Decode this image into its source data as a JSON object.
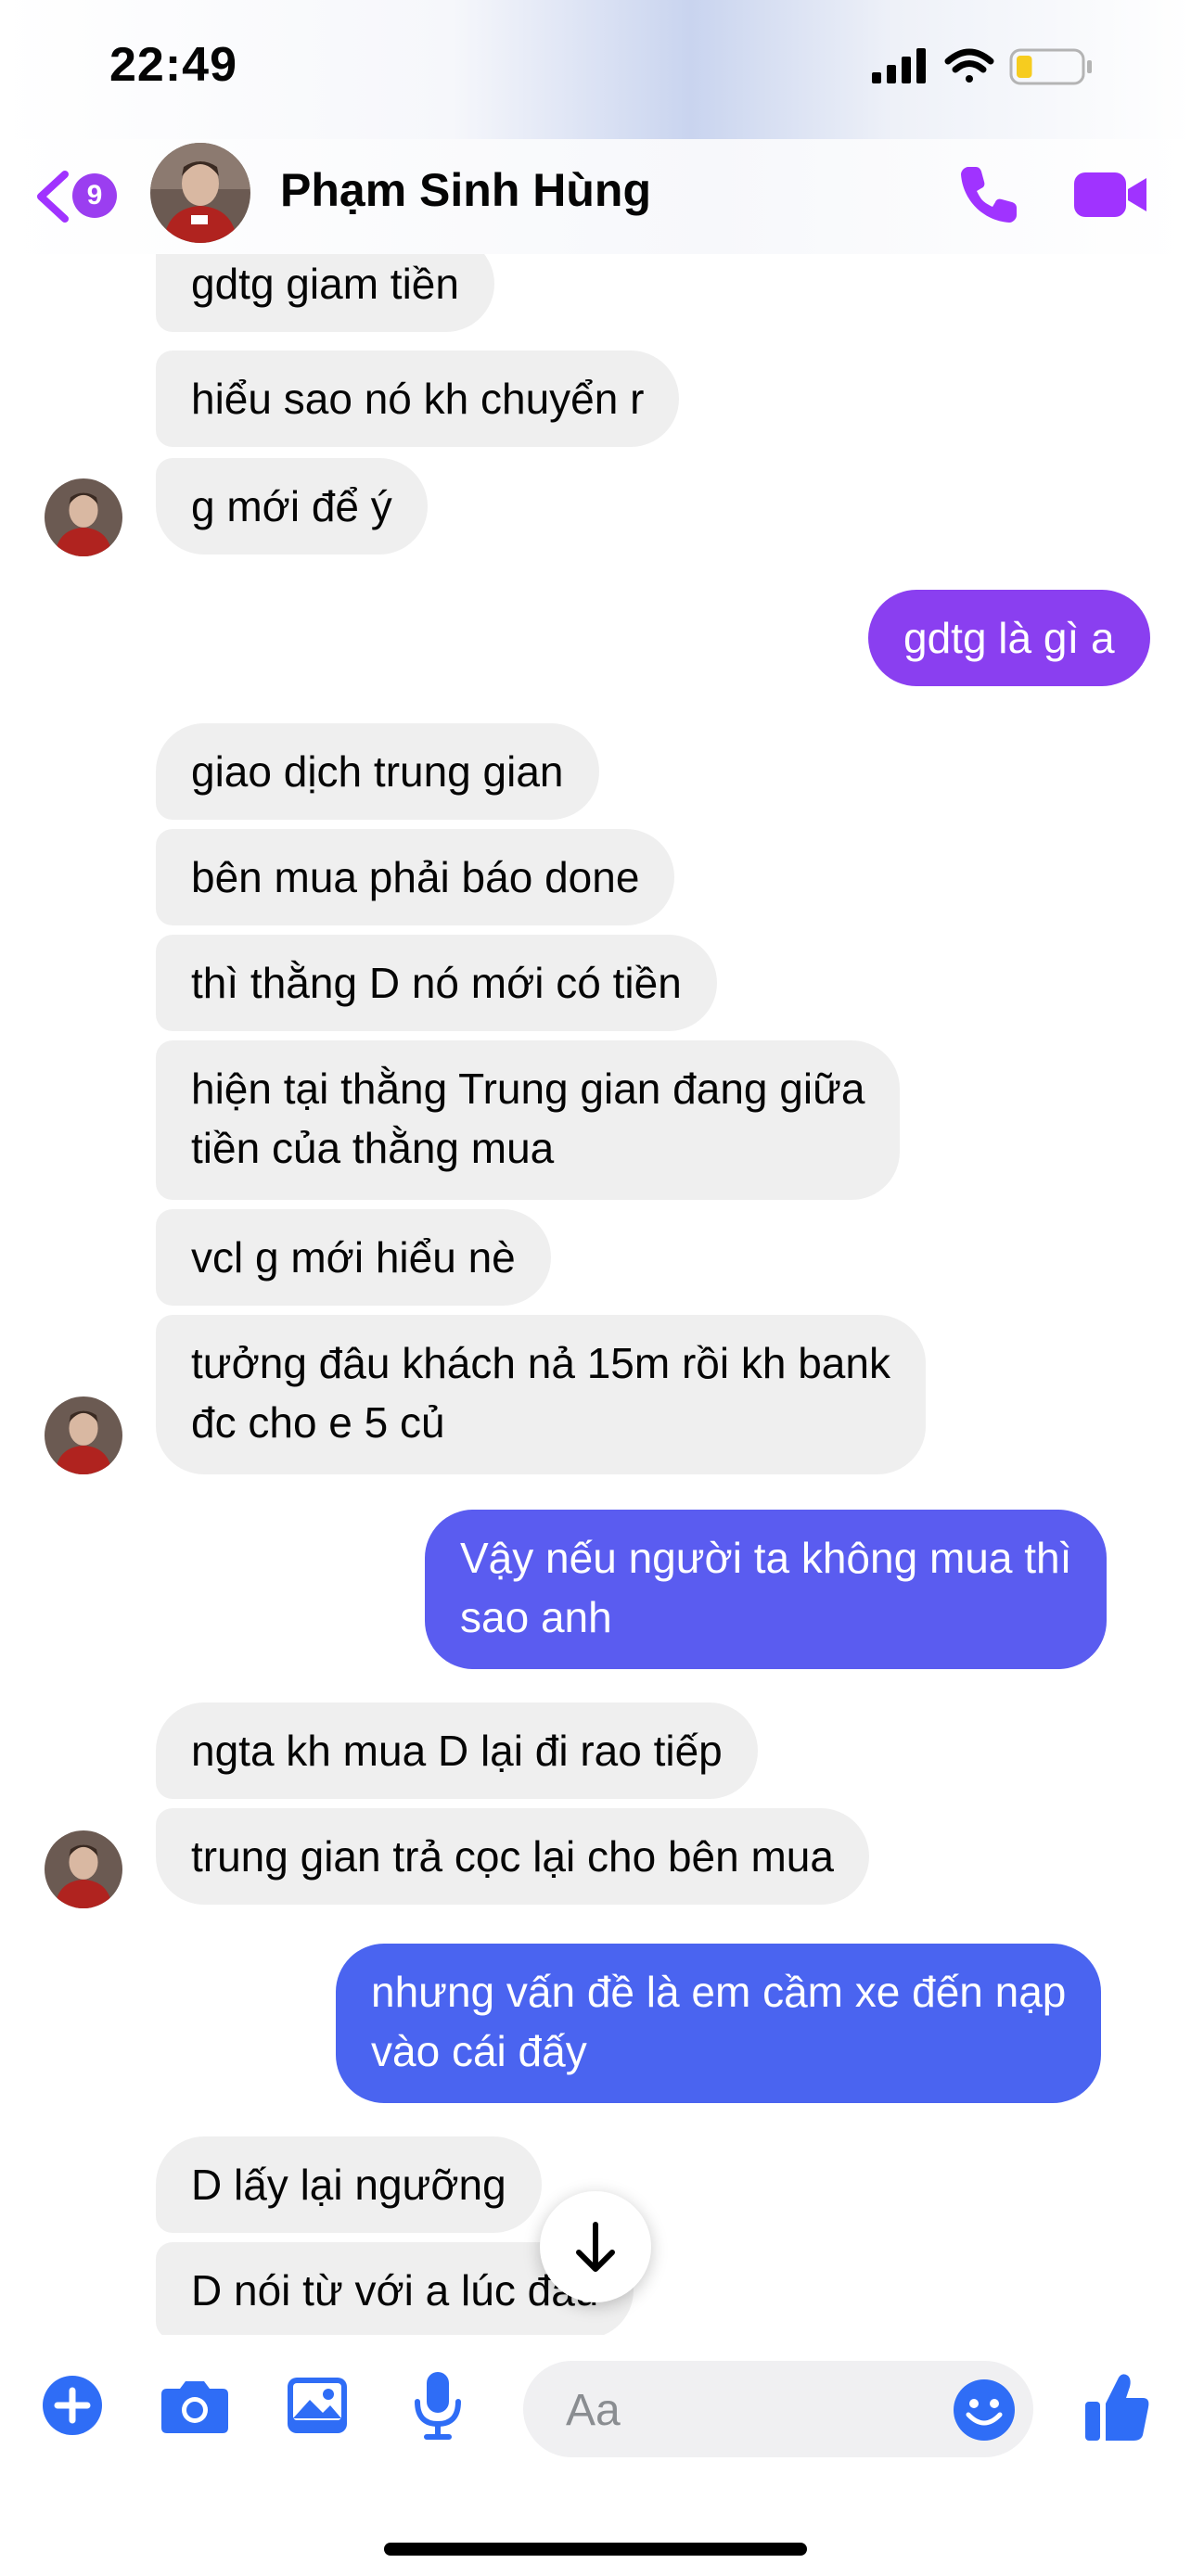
{
  "status_bar": {
    "time": "22:49",
    "battery_level": 0.25
  },
  "header": {
    "back_badge": "9",
    "contact_name": "Phạm Sinh Hùng"
  },
  "messages": [
    {
      "from": "them",
      "text": "gdtg giam tiền"
    },
    {
      "from": "them",
      "text": "hiểu sao nó kh chuyển r"
    },
    {
      "from": "them",
      "text": "g mới để ý"
    },
    {
      "from": "me",
      "text": "gdtg là gì a"
    },
    {
      "from": "them",
      "text": "giao dịch trung gian"
    },
    {
      "from": "them",
      "text": "bên mua phải báo done"
    },
    {
      "from": "them",
      "text": "thì thằng D nó mới có tiền"
    },
    {
      "from": "them",
      "text": "hiện tại thằng Trung gian đang giữa\ntiền của thằng mua"
    },
    {
      "from": "them",
      "text": "vcl g mới hiểu nè"
    },
    {
      "from": "them",
      "text": "tưởng đâu khách nả 15m rồi kh bank\nđc cho e 5 củ"
    },
    {
      "from": "me",
      "text": "Vậy nếu người ta không mua thì\nsao anh"
    },
    {
      "from": "them",
      "text": "ngta kh mua D lại đi rao tiếp"
    },
    {
      "from": "them",
      "text": "trung gian trả cọc lại cho bên mua"
    },
    {
      "from": "me",
      "text": "nhưng vấn đề là em cầm xe đến nạp\nvào cái đấy"
    },
    {
      "from": "them",
      "text": "D lấy lại ngưỡng"
    },
    {
      "from": "them",
      "text": "D nói từ với a lúc đầu"
    }
  ],
  "composer": {
    "placeholder": "Aa"
  },
  "colors": {
    "accent": "#a033ff",
    "incoming": "#efefef",
    "outgoing_purple": "#8a3ff0",
    "outgoing_blue": "#4a64f0"
  },
  "icons": [
    "plus-circle-icon",
    "camera-icon",
    "image-icon",
    "microphone-icon",
    "emoji-icon",
    "thumbs-up-icon"
  ]
}
